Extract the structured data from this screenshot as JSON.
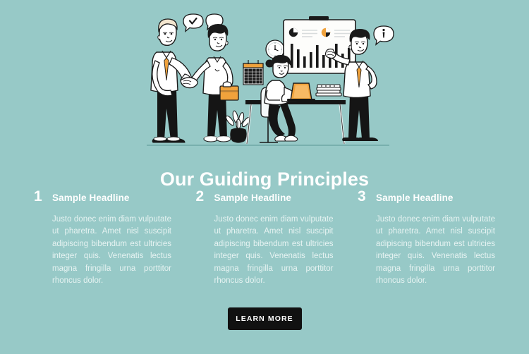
{
  "theme": {
    "background_color": "#97c9c7",
    "text_color": "#ffffff",
    "body_text_color": "#eaf5f4",
    "button_color": "#111111",
    "accent_orange": "#f0a23c",
    "line_color": "#1a1a1a"
  },
  "hero": {
    "alt": "office-teamwork-illustration",
    "elements": {
      "handshake_left_person": "man-with-orange-tie-shaking-hands",
      "handshake_right_person": "man-holding-orange-folder",
      "speech_bubble_check": "check-mark",
      "speech_bubble_exclaim": "exclamation-mark",
      "wall_clock": "analog-clock",
      "wall_calendar": "calendar",
      "presentation_board": "whiteboard-with-charts",
      "seated_person": "woman-at-desk-with-laptop",
      "laptop": "orange-laptop",
      "books": "stacked-books",
      "plant": "potted-plant",
      "presenter": "man-pointing-at-board"
    }
  },
  "heading": {
    "title": "Our Guiding Principles"
  },
  "columns": [
    {
      "number": "1",
      "title": "Sample Headline",
      "body": "Justo donec enim diam vulputate ut pharetra. Amet nisl suscipit adipiscing bibendum est ultricies integer quis. Venenatis lectus magna fringilla urna porttitor rhoncus dolor."
    },
    {
      "number": "2",
      "title": "Sample Headline",
      "body": "Justo donec enim diam vulputate ut pharetra. Amet nisl suscipit adipiscing bibendum est ultricies integer quis. Venenatis lectus magna fringilla urna porttitor rhoncus dolor."
    },
    {
      "number": "3",
      "title": "Sample Headline",
      "body": "Justo donec enim diam vulputate ut pharetra. Amet nisl suscipit adipiscing bibendum est ultricies integer quis. Venenatis lectus magna fringilla urna porttitor rhoncus dolor."
    }
  ],
  "cta": {
    "label": "LEARN MORE"
  }
}
